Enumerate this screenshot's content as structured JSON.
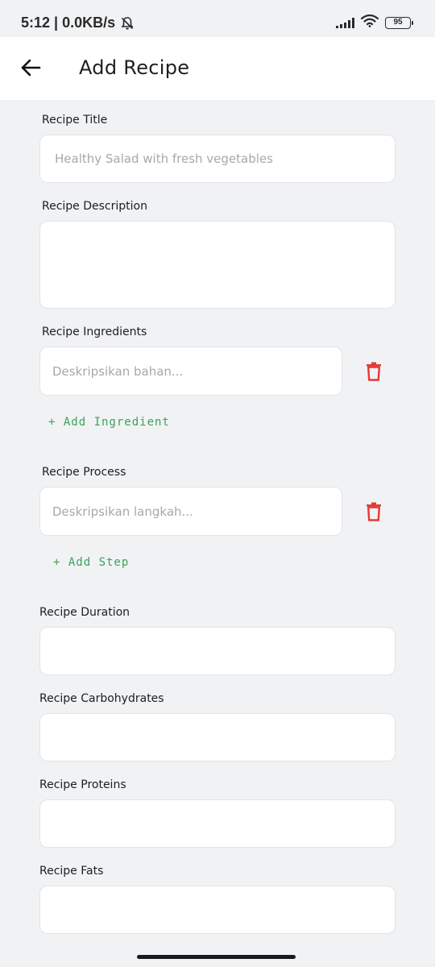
{
  "status": {
    "time_speed": "5:12 | 0.0KB/s",
    "battery": "95"
  },
  "appbar": {
    "title": "Add Recipe"
  },
  "form": {
    "title": {
      "label": "Recipe Title",
      "placeholder": "Healthy Salad with fresh vegetables"
    },
    "description": {
      "label": "Recipe Description",
      "placeholder": ""
    },
    "ingredients": {
      "label": "Recipe Ingredients",
      "placeholder": "Deskripsikan bahan...",
      "add_label": "+ Add Ingredient"
    },
    "process": {
      "label": "Recipe Process",
      "placeholder": "Deskripsikan langkah...",
      "add_label": "+ Add Step"
    },
    "duration": {
      "label": "Recipe Duration"
    },
    "carbohydrates": {
      "label": "Recipe Carbohydrates"
    },
    "proteins": {
      "label": "Recipe Proteins"
    },
    "fats": {
      "label": "Recipe Fats"
    }
  },
  "colors": {
    "accent_green": "#3aa35a",
    "delete_red": "#e53935"
  },
  "icons": {
    "back": "arrow-left-icon",
    "delete": "trash-icon",
    "bell_off": "bell-off-icon",
    "signal": "signal-icon",
    "wifi": "wifi-icon",
    "battery": "battery-icon"
  }
}
